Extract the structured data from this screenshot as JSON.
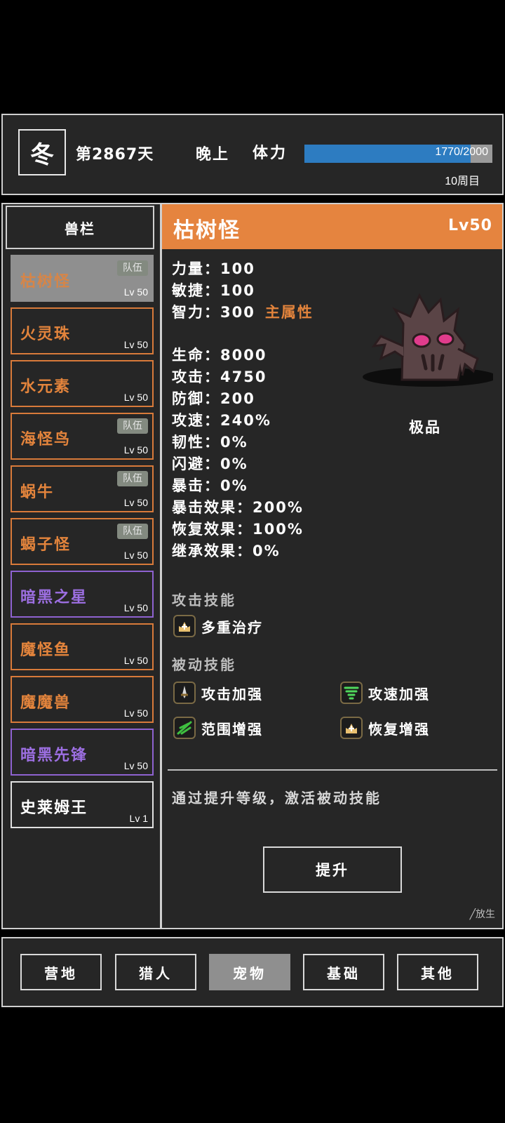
{
  "topbar": {
    "season": "冬",
    "day": "第2867天",
    "time_of_day": "晚上",
    "stamina_label": "体力",
    "stamina_text": "1770/2000",
    "stamina_fraction": 0.885,
    "round": "10周目"
  },
  "list": {
    "header": "兽栏",
    "items": [
      {
        "name": "枯树怪",
        "level": "Lv 50",
        "team": "队伍",
        "style": "selected"
      },
      {
        "name": "火灵珠",
        "level": "Lv 50",
        "team": "",
        "style": "orange"
      },
      {
        "name": "水元素",
        "level": "Lv 50",
        "team": "",
        "style": "orange"
      },
      {
        "name": "海怪鸟",
        "level": "Lv 50",
        "team": "队伍",
        "style": "orange"
      },
      {
        "name": "蜗牛",
        "level": "Lv 50",
        "team": "队伍",
        "style": "orange"
      },
      {
        "name": "蝎子怪",
        "level": "Lv 50",
        "team": "队伍",
        "style": "orange"
      },
      {
        "name": "暗黑之星",
        "level": "Lv 50",
        "team": "",
        "style": "purple"
      },
      {
        "name": "魔怪鱼",
        "level": "Lv 50",
        "team": "",
        "style": "orange"
      },
      {
        "name": "魔魔兽",
        "level": "Lv 50",
        "team": "",
        "style": "orange"
      },
      {
        "name": "暗黑先锋",
        "level": "Lv 50",
        "team": "",
        "style": "purple"
      },
      {
        "name": "史莱姆王",
        "level": "Lv 1",
        "team": "",
        "style": "white"
      }
    ]
  },
  "detail": {
    "name": "枯树怪",
    "level": "Lv50",
    "stats": [
      {
        "text": "力量：100"
      },
      {
        "text": "敏捷：100"
      },
      {
        "text": "智力：300",
        "accent": "主属性"
      },
      {
        "text": "生命：8000"
      },
      {
        "text": "攻击：4750"
      },
      {
        "text": "防御：200"
      },
      {
        "text": "攻速：240%"
      },
      {
        "text": "韧性：0%"
      },
      {
        "text": "闪避：0%"
      },
      {
        "text": "暴击：0%"
      },
      {
        "text": "暴击效果：200%"
      },
      {
        "text": "恢复效果：100%"
      },
      {
        "text": "继承效果：0%"
      }
    ],
    "quality": "极品",
    "attack_skill_title": "攻击技能",
    "attack_skills": [
      "多重治疗"
    ],
    "passive_skill_title": "被动技能",
    "passive_skills": [
      "攻击加强",
      "攻速加强",
      "范围增强",
      "恢复增强"
    ],
    "hint": "通过提升等级，激活被动技能",
    "upgrade_label": "提升",
    "release_label": "╱放生"
  },
  "nav": {
    "items": [
      "营地",
      "猎人",
      "宠物",
      "基础",
      "其他"
    ],
    "active": "宠物"
  },
  "colors": {
    "accent_orange": "#e5843f",
    "epic_purple": "#8e62d0",
    "stamina_blue": "#2d7cc1"
  }
}
